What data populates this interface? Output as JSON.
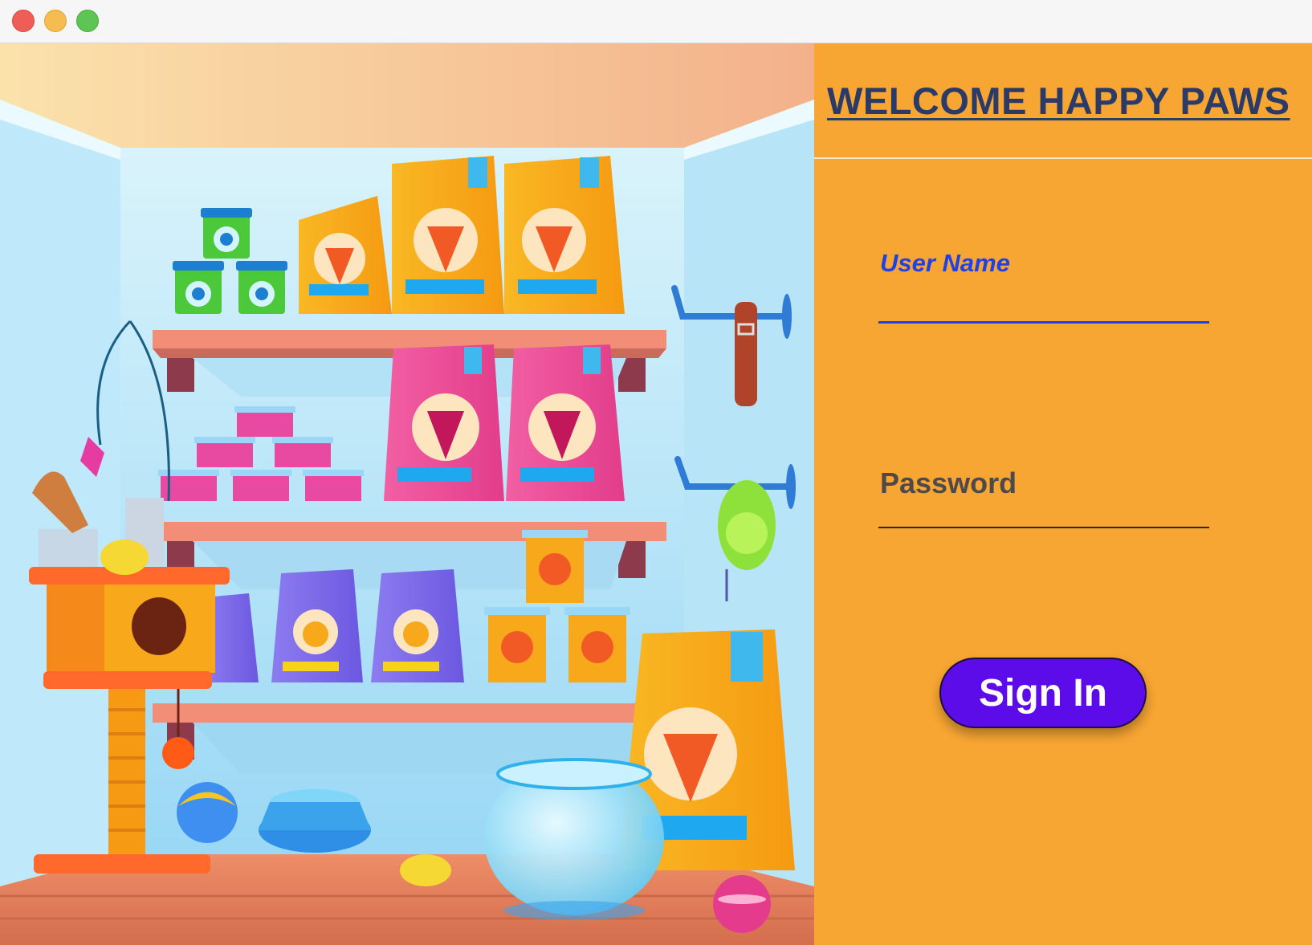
{
  "window": {
    "controls": [
      "close",
      "minimize",
      "zoom"
    ]
  },
  "panel": {
    "title": "WELCOME  HAPPY PAWS"
  },
  "form": {
    "username_label": "User Name",
    "username_value": "",
    "password_label": "Password",
    "password_value": "",
    "signin_label": "Sign In"
  },
  "colors": {
    "panel_background": "#f8a633",
    "title": "#2b3a67",
    "username_accent": "#1f41e8",
    "button": "#5c0ce8"
  },
  "illustration": {
    "subject": "pet-shop-shelves"
  }
}
